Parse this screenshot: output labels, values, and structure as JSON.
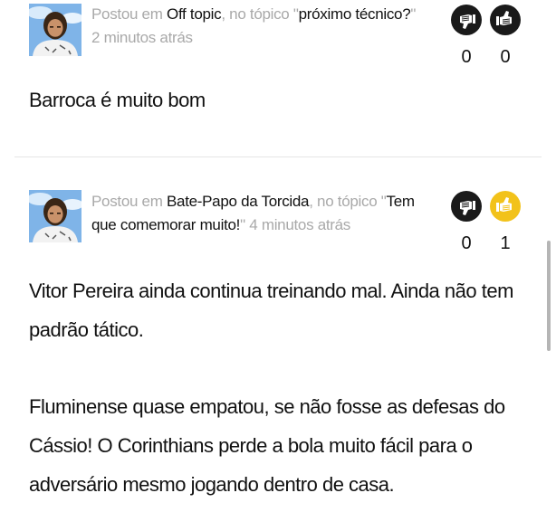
{
  "posts": [
    {
      "meta": {
        "posted_in_label": "Postou em",
        "forum": "Off topic",
        "topic_label": ", no tópico ",
        "quote_open": "\"",
        "topic": "próximo técnico?",
        "quote_close": "\"",
        "time": "2 minutos atrás"
      },
      "votes": {
        "down_count": "0",
        "up_count": "0",
        "down_icon": "thumbs-down-icon",
        "up_icon": "thumbs-up-icon",
        "up_active": false
      },
      "paragraphs": [
        "Barroca é muito bom"
      ]
    },
    {
      "meta": {
        "posted_in_label": "Postou em",
        "forum": "Bate-Papo da Torcida",
        "topic_label": ", no tópico ",
        "quote_open": "\"",
        "topic": "Tem que comemorar muito!",
        "quote_close": "\"",
        "time": "4 minutos atrás"
      },
      "votes": {
        "down_count": "0",
        "up_count": "1",
        "down_icon": "thumbs-down-icon",
        "up_icon": "thumbs-up-icon",
        "up_active": true
      },
      "paragraphs": [
        "Vitor Pereira ainda continua treinando mal. Ainda não tem padrão tático.",
        "Fluminense quase empatou, se não fosse as defesas do Cássio! O Corinthians perde a bola muito fácil para o adversário mesmo jogando dentro de casa."
      ]
    }
  ],
  "colors": {
    "meta_gray": "#a9a9a9",
    "text": "#111111",
    "icon_dark": "#1a1a1a",
    "icon_active": "#f2c21a"
  }
}
